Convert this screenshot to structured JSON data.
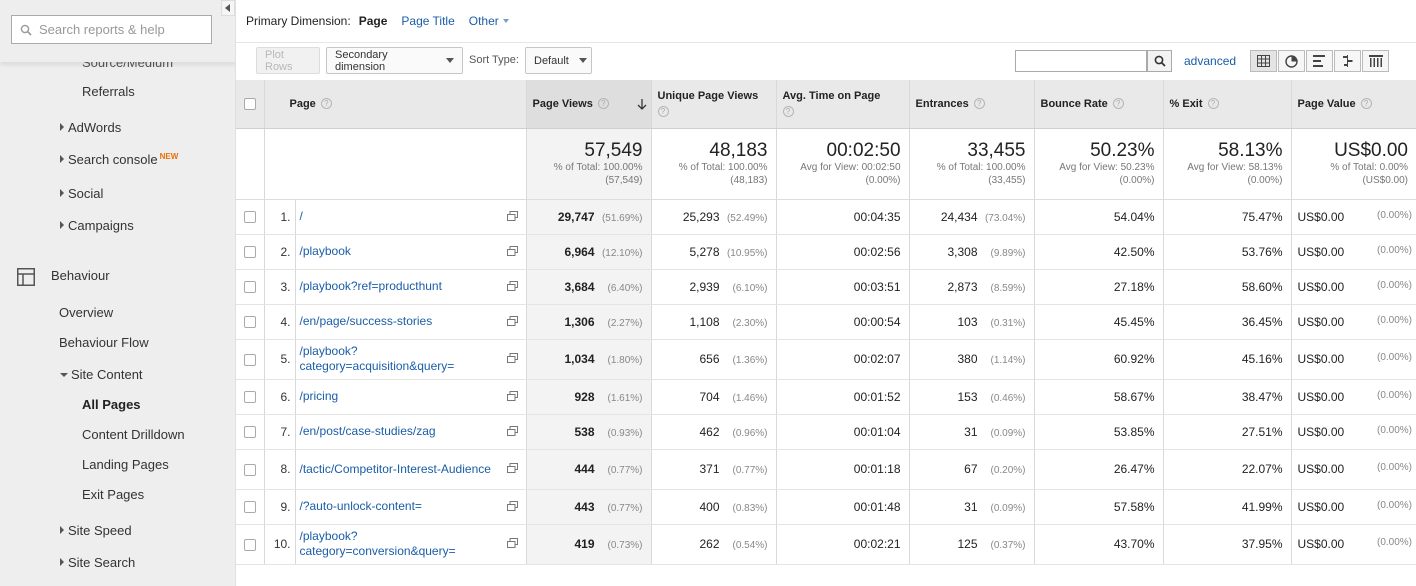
{
  "sidebar": {
    "search_placeholder": "Search reports & help",
    "items": [
      {
        "label": "Source/Medium"
      },
      {
        "label": "Referrals"
      },
      {
        "label": "AdWords"
      },
      {
        "label": "Search console",
        "badge": "NEW"
      },
      {
        "label": "Social"
      },
      {
        "label": "Campaigns"
      },
      {
        "label": "Behaviour"
      },
      {
        "label": "Overview"
      },
      {
        "label": "Behaviour Flow"
      },
      {
        "label": "Site Content"
      },
      {
        "label": "All Pages"
      },
      {
        "label": "Content Drilldown"
      },
      {
        "label": "Landing Pages"
      },
      {
        "label": "Exit Pages"
      },
      {
        "label": "Site Speed"
      },
      {
        "label": "Site Search"
      }
    ]
  },
  "primary_dimension": {
    "label": "Primary Dimension:",
    "current": "Page",
    "option_title": "Page Title",
    "option_other": "Other"
  },
  "toolbar": {
    "plot_rows": "Plot Rows",
    "secondary_dimension": "Secondary dimension",
    "sort_type_label": "Sort Type:",
    "sort_type_value": "Default",
    "advanced": "advanced"
  },
  "table": {
    "headers": {
      "page": "Page",
      "page_views": "Page Views",
      "unique_page_views": "Unique Page Views",
      "avg_time": "Avg. Time on Page",
      "entrances": "Entrances",
      "bounce_rate": "Bounce Rate",
      "exit": "% Exit",
      "page_value": "Page Value"
    },
    "totals": {
      "page_views": {
        "value": "57,549",
        "sub1": "% of Total: 100.00%",
        "sub2": "(57,549)"
      },
      "unique_page_views": {
        "value": "48,183",
        "sub1": "% of Total: 100.00%",
        "sub2": "(48,183)"
      },
      "avg_time": {
        "value": "00:02:50",
        "sub1": "Avg for View: 00:02:50",
        "sub2": "(0.00%)"
      },
      "entrances": {
        "value": "33,455",
        "sub1": "% of Total: 100.00%",
        "sub2": "(33,455)"
      },
      "bounce_rate": {
        "value": "50.23%",
        "sub1": "Avg for View: 50.23%",
        "sub2": "(0.00%)"
      },
      "exit": {
        "value": "58.13%",
        "sub1": "Avg for View: 58.13%",
        "sub2": "(0.00%)"
      },
      "page_value": {
        "value": "US$0.00",
        "sub1": "% of Total: 0.00%",
        "sub2": "(US$0.00)"
      }
    },
    "rows": [
      {
        "rank": "1.",
        "page": "/",
        "pv": "29,747",
        "pv_pct": "(51.69%)",
        "upv": "25,293",
        "upv_pct": "(52.49%)",
        "time": "00:04:35",
        "ent": "24,434",
        "ent_pct": "(73.04%)",
        "bounce": "54.04%",
        "exit": "75.47%",
        "value": "US$0.00",
        "value_pct": "(0.00%)"
      },
      {
        "rank": "2.",
        "page": "/playbook",
        "pv": "6,964",
        "pv_pct": "(12.10%)",
        "upv": "5,278",
        "upv_pct": "(10.95%)",
        "time": "00:02:56",
        "ent": "3,308",
        "ent_pct": "(9.89%)",
        "bounce": "42.50%",
        "exit": "53.76%",
        "value": "US$0.00",
        "value_pct": "(0.00%)"
      },
      {
        "rank": "3.",
        "page": "/playbook?ref=producthunt",
        "pv": "3,684",
        "pv_pct": "(6.40%)",
        "upv": "2,939",
        "upv_pct": "(6.10%)",
        "time": "00:03:51",
        "ent": "2,873",
        "ent_pct": "(8.59%)",
        "bounce": "27.18%",
        "exit": "58.60%",
        "value": "US$0.00",
        "value_pct": "(0.00%)"
      },
      {
        "rank": "4.",
        "page": "/en/page/success-stories",
        "pv": "1,306",
        "pv_pct": "(2.27%)",
        "upv": "1,108",
        "upv_pct": "(2.30%)",
        "time": "00:00:54",
        "ent": "103",
        "ent_pct": "(0.31%)",
        "bounce": "45.45%",
        "exit": "36.45%",
        "value": "US$0.00",
        "value_pct": "(0.00%)"
      },
      {
        "rank": "5.",
        "page": "/playbook?category=acquisition&query=",
        "pv": "1,034",
        "pv_pct": "(1.80%)",
        "upv": "656",
        "upv_pct": "(1.36%)",
        "time": "00:02:07",
        "ent": "380",
        "ent_pct": "(1.14%)",
        "bounce": "60.92%",
        "exit": "45.16%",
        "value": "US$0.00",
        "value_pct": "(0.00%)"
      },
      {
        "rank": "6.",
        "page": "/pricing",
        "pv": "928",
        "pv_pct": "(1.61%)",
        "upv": "704",
        "upv_pct": "(1.46%)",
        "time": "00:01:52",
        "ent": "153",
        "ent_pct": "(0.46%)",
        "bounce": "58.67%",
        "exit": "38.47%",
        "value": "US$0.00",
        "value_pct": "(0.00%)"
      },
      {
        "rank": "7.",
        "page": "/en/post/case-studies/zag",
        "pv": "538",
        "pv_pct": "(0.93%)",
        "upv": "462",
        "upv_pct": "(0.96%)",
        "time": "00:01:04",
        "ent": "31",
        "ent_pct": "(0.09%)",
        "bounce": "53.85%",
        "exit": "27.51%",
        "value": "US$0.00",
        "value_pct": "(0.00%)"
      },
      {
        "rank": "8.",
        "page": "/tactic/Competitor-Interest-Audience",
        "pv": "444",
        "pv_pct": "(0.77%)",
        "upv": "371",
        "upv_pct": "(0.77%)",
        "time": "00:01:18",
        "ent": "67",
        "ent_pct": "(0.20%)",
        "bounce": "26.47%",
        "exit": "22.07%",
        "value": "US$0.00",
        "value_pct": "(0.00%)"
      },
      {
        "rank": "9.",
        "page": "/?auto-unlock-content=",
        "pv": "443",
        "pv_pct": "(0.77%)",
        "upv": "400",
        "upv_pct": "(0.83%)",
        "time": "00:01:48",
        "ent": "31",
        "ent_pct": "(0.09%)",
        "bounce": "57.58%",
        "exit": "41.99%",
        "value": "US$0.00",
        "value_pct": "(0.00%)"
      },
      {
        "rank": "10.",
        "page": "/playbook?category=conversion&query=",
        "pv": "419",
        "pv_pct": "(0.73%)",
        "upv": "262",
        "upv_pct": "(0.54%)",
        "time": "00:02:21",
        "ent": "125",
        "ent_pct": "(0.37%)",
        "bounce": "43.70%",
        "exit": "37.95%",
        "value": "US$0.00",
        "value_pct": "(0.00%)"
      }
    ]
  },
  "icons": [
    "search-icon",
    "chevron-left-icon",
    "behaviour-icon",
    "external-link-icon",
    "sort-desc-icon",
    "table-view-icon",
    "pie-view-icon",
    "bar-view-icon",
    "comparison-view-icon",
    "pivot-view-icon"
  ],
  "colors": {
    "link": "#1a5da8",
    "badge_new": "#e8710a",
    "sidebar_bg": "#eeeeee",
    "header_bg": "#e9e9e9"
  }
}
